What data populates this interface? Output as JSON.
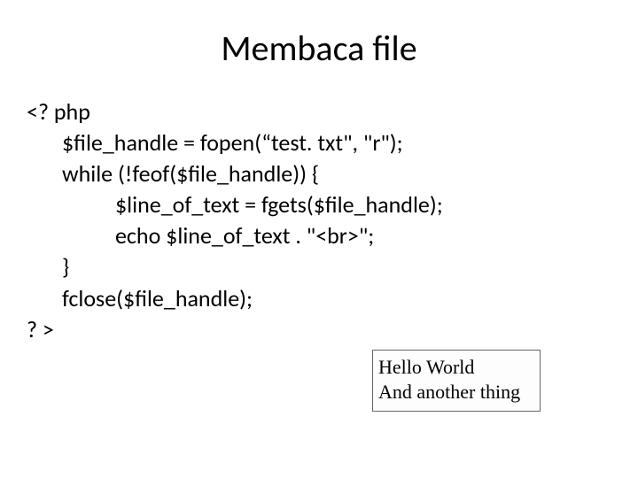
{
  "title": "Membaca file",
  "code": {
    "l1": "<? php",
    "l2": "$file_handle = fopen(“test. txt\", \"r\");",
    "l3": "while (!feof($file_handle)) {",
    "l4": "$line_of_text = fgets($file_handle);",
    "l5": "echo $line_of_text . \"<br>\";",
    "l6": "}",
    "l7": "fclose($file_handle);",
    "l8": "? >"
  },
  "output": {
    "line1": "Hello World",
    "line2": "And another thing"
  }
}
